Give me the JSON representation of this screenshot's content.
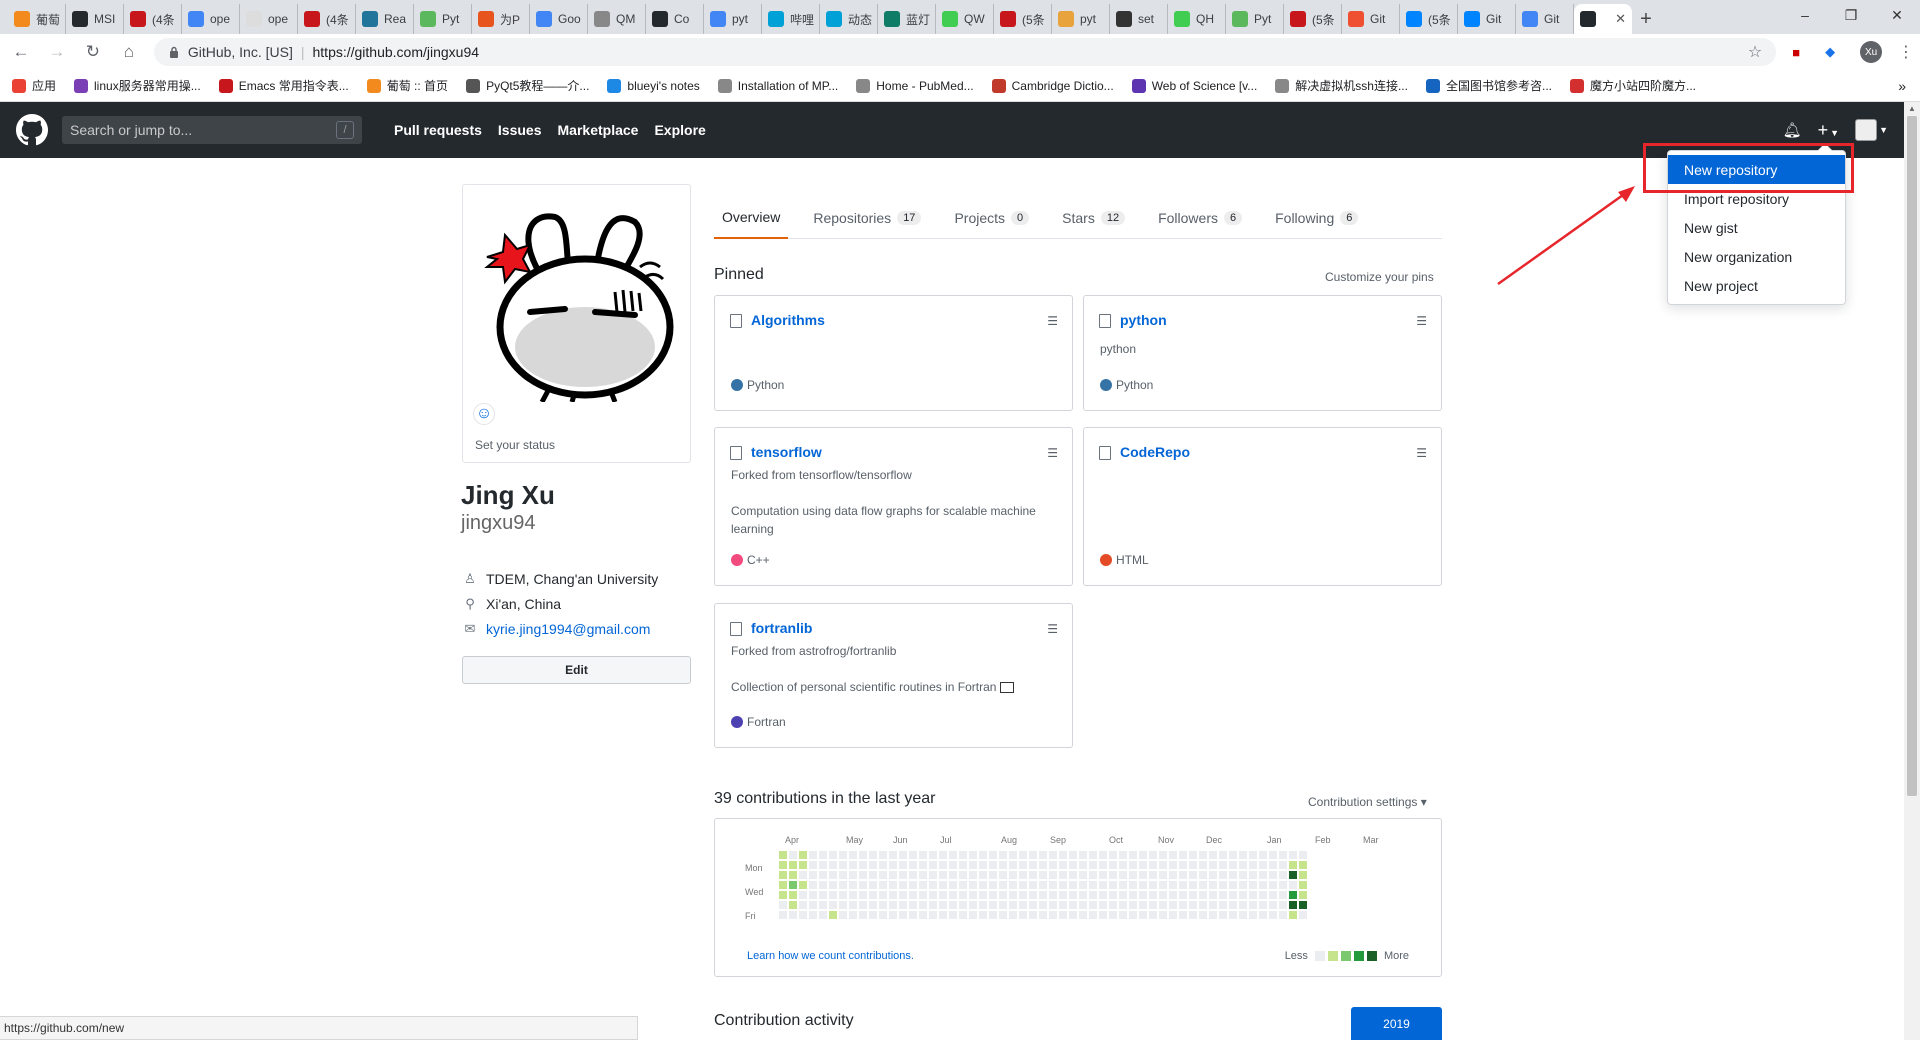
{
  "browser": {
    "tabs": [
      {
        "label": "葡萄",
        "color": "#f28a1d"
      },
      {
        "label": "MSI",
        "color": "#24292e"
      },
      {
        "label": "(4条",
        "color": "#c8161d"
      },
      {
        "label": "ope",
        "color": "#4285f4"
      },
      {
        "label": "ope",
        "color": "#dddddd"
      },
      {
        "label": "(4条",
        "color": "#c8161d"
      },
      {
        "label": "Rea",
        "color": "#21759b"
      },
      {
        "label": "Pyt",
        "color": "#5cb85c"
      },
      {
        "label": "为P",
        "color": "#e8541e"
      },
      {
        "label": "Goo",
        "color": "#4285f4"
      },
      {
        "label": "QM",
        "color": "#888888"
      },
      {
        "label": "Co",
        "color": "#24292e"
      },
      {
        "label": "pyt",
        "color": "#4285f4"
      },
      {
        "label": "哔哩",
        "color": "#00a1d6"
      },
      {
        "label": "动态",
        "color": "#00a1d6"
      },
      {
        "label": "蓝灯",
        "color": "#0e7c66"
      },
      {
        "label": "QW",
        "color": "#41cd52"
      },
      {
        "label": "(5条",
        "color": "#c8161d"
      },
      {
        "label": "pyt",
        "color": "#e8a33d"
      },
      {
        "label": "set",
        "color": "#333333"
      },
      {
        "label": "QH",
        "color": "#41cd52"
      },
      {
        "label": "Pyt",
        "color": "#5cb85c"
      },
      {
        "label": "(5条",
        "color": "#c8161d"
      },
      {
        "label": "Git",
        "color": "#f05032"
      },
      {
        "label": "(5条",
        "color": "#0084ff"
      },
      {
        "label": "Git",
        "color": "#0084ff"
      },
      {
        "label": "Git",
        "color": "#4285f4"
      },
      {
        "label": "",
        "color": "#24292e",
        "active": true
      }
    ],
    "address": {
      "org": "GitHub, Inc. [US]",
      "url": "https://github.com/jingxu94"
    },
    "profile_initials": "Xu",
    "bookmarks": [
      {
        "label": "应用",
        "color": "#ea4335"
      },
      {
        "label": "linux服务器常用操...",
        "color": "#7b3fb5"
      },
      {
        "label": "Emacs 常用指令表...",
        "color": "#c8161d"
      },
      {
        "label": "葡萄 :: 首页",
        "color": "#f28a1d"
      },
      {
        "label": "PyQt5教程——介...",
        "color": "#555555"
      },
      {
        "label": "blueyi's notes",
        "color": "#1e88e5"
      },
      {
        "label": "Installation of MP...",
        "color": "#888888"
      },
      {
        "label": "Home - PubMed...",
        "color": "#888888"
      },
      {
        "label": "Cambridge Dictio...",
        "color": "#c0392b"
      },
      {
        "label": "Web of Science [v...",
        "color": "#5e35b1"
      },
      {
        "label": "解决虚拟机ssh连接...",
        "color": "#888888"
      },
      {
        "label": "全国图书馆参考咨...",
        "color": "#1565c0"
      },
      {
        "label": "魔方小站四阶魔方...",
        "color": "#d32f2f"
      }
    ],
    "status_url": "https://github.com/new"
  },
  "github": {
    "search_placeholder": "Search or jump to...",
    "search_key": "/",
    "nav": [
      "Pull requests",
      "Issues",
      "Marketplace",
      "Explore"
    ],
    "new_menu": [
      "New repository",
      "Import repository",
      "New gist",
      "New organization",
      "New project"
    ]
  },
  "profile": {
    "set_status": "Set your status",
    "name": "Jing Xu",
    "login": "jingxu94",
    "org": "TDEM, Chang'an University",
    "location": "Xi'an, China",
    "email": "kyrie.jing1994@gmail.com",
    "edit_label": "Edit"
  },
  "tabs": [
    {
      "label": "Overview",
      "count": ""
    },
    {
      "label": "Repositories",
      "count": "17"
    },
    {
      "label": "Projects",
      "count": "0"
    },
    {
      "label": "Stars",
      "count": "12"
    },
    {
      "label": "Followers",
      "count": "6"
    },
    {
      "label": "Following",
      "count": "6"
    }
  ],
  "pinned": {
    "title": "Pinned",
    "customize": "Customize your pins",
    "repos": [
      {
        "name": "Algorithms",
        "fork": "",
        "desc": "",
        "lang": "Python",
        "lang_color": "#3572A5"
      },
      {
        "name": "python",
        "fork": "",
        "desc": "python",
        "lang": "Python",
        "lang_color": "#3572A5"
      },
      {
        "name": "tensorflow",
        "fork": "Forked from tensorflow/tensorflow",
        "desc": "Computation using data flow graphs for scalable machine learning",
        "lang": "C++",
        "lang_color": "#f34b7d"
      },
      {
        "name": "CodeRepo",
        "fork": "",
        "desc": "",
        "lang": "HTML",
        "lang_color": "#e34c26"
      },
      {
        "name": "fortranlib",
        "fork": "Forked from astrofrog/fortranlib",
        "desc": "Collection of personal scientific routines in Fortran",
        "lang": "Fortran",
        "lang_color": "#4d41b1"
      }
    ]
  },
  "contributions": {
    "title": "39 contributions in the last year",
    "settings": "Contribution settings ▾",
    "months": [
      "Apr",
      "May",
      "Jun",
      "Jul",
      "Aug",
      "Sep",
      "Oct",
      "Nov",
      "Dec",
      "Jan",
      "Feb",
      "Mar"
    ],
    "weekdays": [
      "Mon",
      "Wed",
      "Fri"
    ],
    "learn": "Learn how we count contributions.",
    "less": "Less",
    "more": "More",
    "levels": [
      "#ebedf0",
      "#c6e48b",
      "#7bc96f",
      "#239a3b",
      "#196127"
    ]
  },
  "activity": {
    "title": "Contribution activity",
    "year": "2019"
  }
}
